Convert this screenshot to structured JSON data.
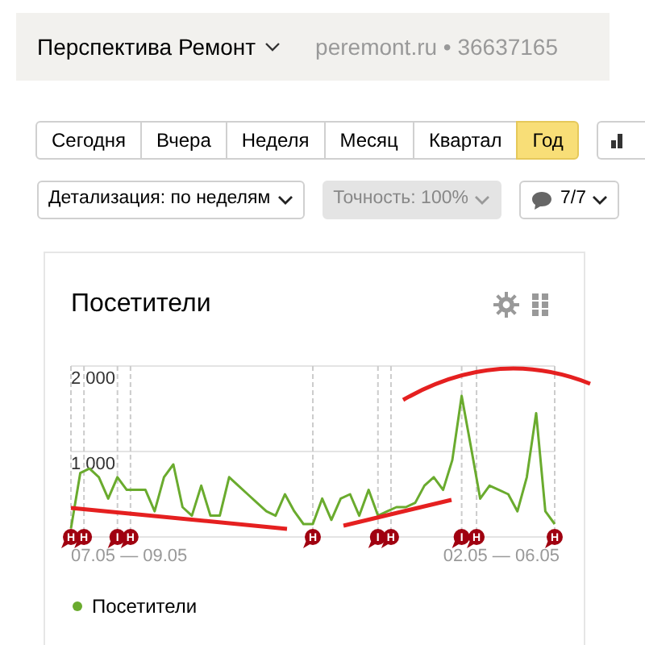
{
  "header": {
    "counter_name": "Перспектива Ремонт",
    "site": "peremont.ru",
    "separator": "•",
    "counter_id": "36637165"
  },
  "periods": [
    {
      "label": "Сегодня",
      "selected": false
    },
    {
      "label": "Вчера",
      "selected": false
    },
    {
      "label": "Неделя",
      "selected": false
    },
    {
      "label": "Месяц",
      "selected": false
    },
    {
      "label": "Квартал",
      "selected": false
    },
    {
      "label": "Год",
      "selected": true
    }
  ],
  "filters": [
    {
      "kind": "select",
      "label": "Детализация: по неделям",
      "disabled": false
    },
    {
      "kind": "select",
      "label": "Точность: 100%",
      "disabled": true
    },
    {
      "kind": "comments",
      "label": "7/7",
      "disabled": false
    }
  ],
  "widget": {
    "title": "Посетители",
    "range_start": "07.05 — 09.05",
    "range_end": "02.05 — 06.05",
    "chart_data": {
      "type": "line",
      "grid": true,
      "ylim": [
        0,
        2000
      ],
      "yticks": [
        {
          "value": 1000,
          "label": "1 000"
        },
        {
          "value": 2000,
          "label": "2 000"
        }
      ],
      "series": [
        {
          "name": "Посетители",
          "color": "#6aab2e",
          "values": [
            100,
            750,
            800,
            700,
            450,
            700,
            550,
            550,
            550,
            300,
            700,
            850,
            350,
            250,
            600,
            250,
            250,
            700,
            600,
            500,
            400,
            300,
            250,
            500,
            300,
            150,
            150,
            450,
            200,
            450,
            500,
            250,
            550,
            250,
            300,
            350,
            350,
            400,
            600,
            700,
            550,
            900,
            1650,
            1050,
            450,
            600,
            550,
            500,
            300,
            700,
            1450,
            300,
            150
          ]
        }
      ],
      "annotations": [
        "Н",
        "Н",
        "I",
        "Н",
        "Н",
        "I",
        "Н",
        "I",
        "Н",
        "Н"
      ]
    }
  }
}
